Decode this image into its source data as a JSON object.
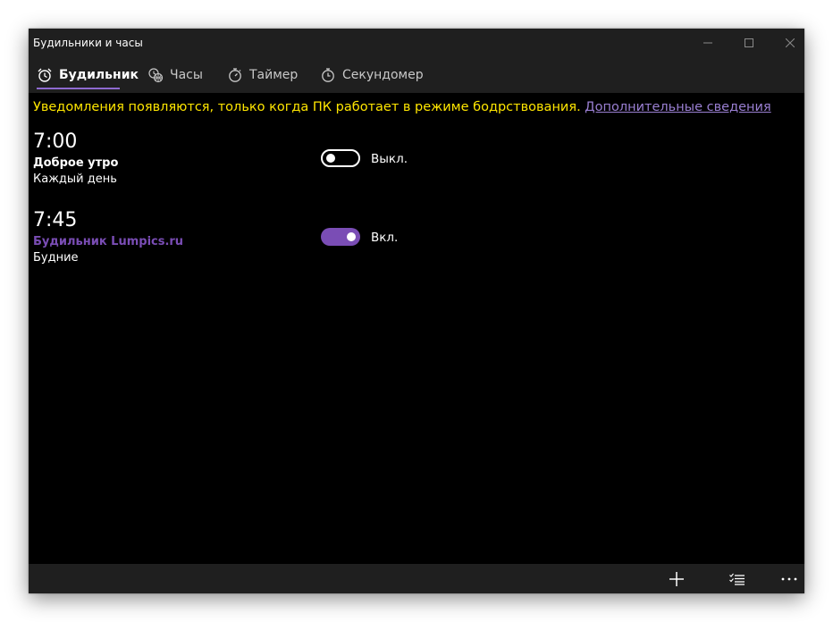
{
  "window": {
    "title": "Будильники и часы"
  },
  "tabs": [
    {
      "label": "Будильник",
      "icon": "alarm-clock-icon"
    },
    {
      "label": "Часы",
      "icon": "world-clock-icon"
    },
    {
      "label": "Таймер",
      "icon": "timer-icon"
    },
    {
      "label": "Секундомер",
      "icon": "stopwatch-icon"
    }
  ],
  "notice": {
    "text": "Уведомления появляются, только когда ПК работает в режиме бодрствования.",
    "link": "Дополнительные сведения",
    "text_color": "#ffe600",
    "link_color": "#9a7fd2"
  },
  "alarms": [
    {
      "time": "7:00",
      "name": "Доброе утро",
      "repeat": "Каждый день",
      "enabled": false,
      "state_label": "Выкл."
    },
    {
      "time": "7:45",
      "name": "Будильник Lumpics.ru",
      "repeat": "Будние",
      "enabled": true,
      "state_label": "Вкл."
    }
  ],
  "bottom_bar": [
    {
      "icon": "add-icon"
    },
    {
      "icon": "select-list-icon"
    },
    {
      "icon": "more-icon"
    }
  ],
  "colors": {
    "accent": "#7a4db5",
    "background": "#000000",
    "chrome": "#1f1f1f"
  }
}
